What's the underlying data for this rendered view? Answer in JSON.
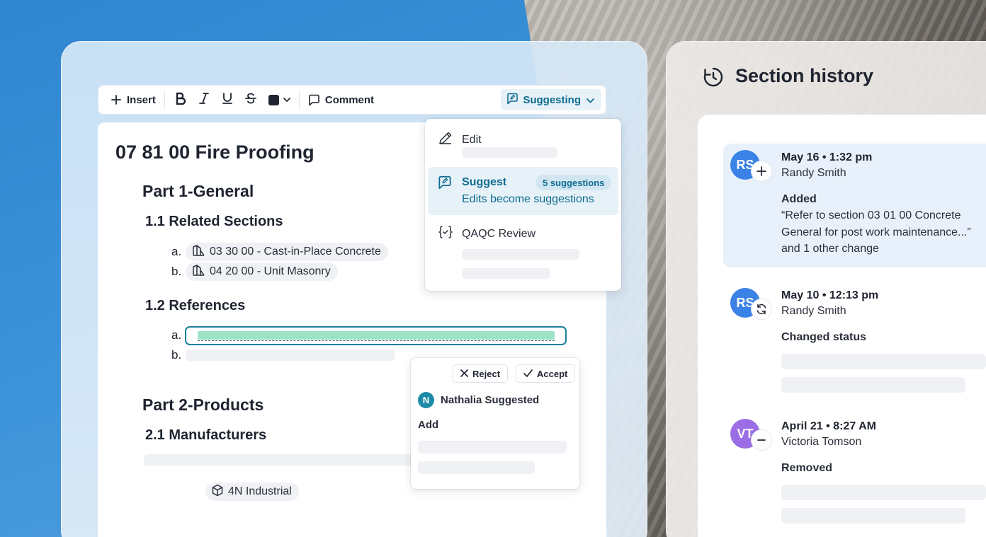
{
  "toolbar": {
    "insert_label": "Insert",
    "comment_label": "Comment",
    "suggesting_label": "Suggesting",
    "text_color": "#1f2430"
  },
  "document": {
    "title": "07 81 00 Fire Proofing",
    "part1_title": "Part 1-General",
    "section_1_1": "1.1 Related Sections",
    "related_sections": [
      {
        "letter": "a.",
        "label": "03 30 00 - Cast-in-Place Concrete",
        "icon": "section-link-icon"
      },
      {
        "letter": "b.",
        "label": "04 20 00 - Unit Masonry",
        "icon": "section-link-icon"
      }
    ],
    "section_1_2": "1.2 References",
    "references": [
      {
        "letter": "a."
      },
      {
        "letter": "b."
      }
    ],
    "part2_title": "Part 2-Products",
    "section_2_1": "2.1 Manufacturers",
    "manufacturer_chip": "4N Industrial"
  },
  "mode_menu": {
    "items": [
      {
        "label": "Edit",
        "icon": "pencil-icon"
      },
      {
        "label": "Suggest",
        "sub": "Edits become suggestions",
        "badge": "5 suggestions",
        "icon": "suggest-icon"
      },
      {
        "label": "QAQC Review",
        "icon": "review-icon"
      }
    ]
  },
  "suggestion_card": {
    "reject_label": "Reject",
    "accept_label": "Accept",
    "avatar_initial": "N",
    "author_text": "Nathalia Suggested",
    "action": "Add"
  },
  "history": {
    "title": "Section history",
    "entries": [
      {
        "initials": "RS",
        "avatar_color": "#3b82e6",
        "badge_icon": "plus-icon",
        "date": "May 16",
        "time": "• 1:32 pm",
        "name": "Randy Smith",
        "action": "Added",
        "text": "“Refer to section 03 01 00 Concrete General for post work maintenance...”",
        "extra": "and 1 other change"
      },
      {
        "initials": "RS",
        "avatar_color": "#3b82e6",
        "badge_icon": "refresh-icon",
        "date": "May 10",
        "time": "• 12:13 pm",
        "name": "Randy Smith",
        "action": "Changed status"
      },
      {
        "initials": "VT",
        "avatar_color": "#9b6ee6",
        "badge_icon": "minus-icon",
        "date": "April 21",
        "time": "• 8:27 AM",
        "name": "Victoria Tomson",
        "action": "Removed"
      }
    ]
  }
}
